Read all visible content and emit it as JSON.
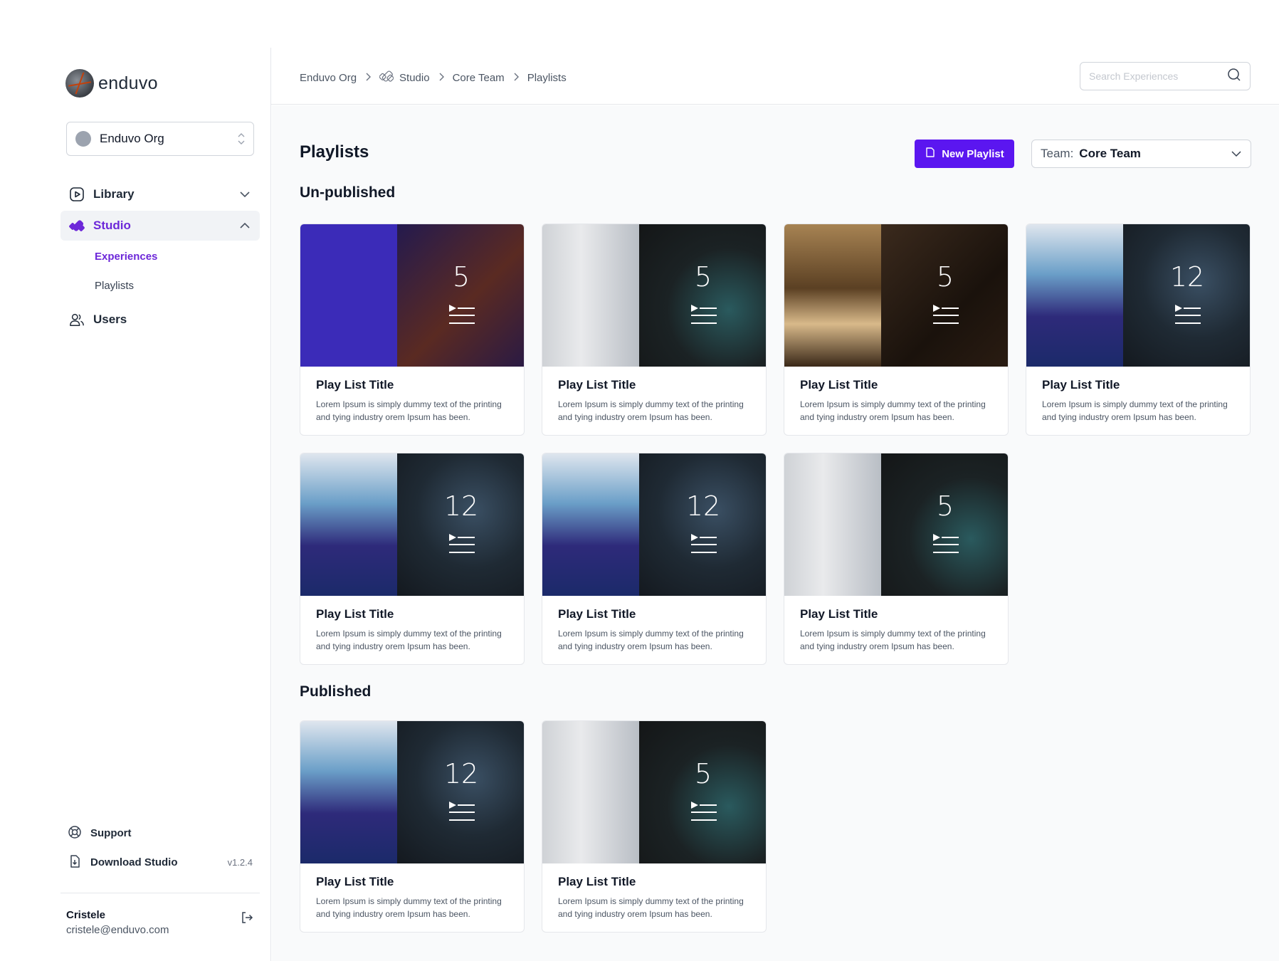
{
  "app": {
    "logo_text": "enduvo"
  },
  "org_select": {
    "name": "Enduvo Org"
  },
  "nav": {
    "library": "Library",
    "studio": "Studio",
    "studio_sub": {
      "experiences": "Experiences",
      "playlists": "Playlists"
    },
    "users": "Users"
  },
  "sidebar_bottom": {
    "support": "Support",
    "download": "Download Studio",
    "version": "v1.2.4"
  },
  "user": {
    "name": "Cristele",
    "email": "cristele@enduvo.com"
  },
  "breadcrumb": [
    "Enduvo Org",
    "Studio",
    "Core Team",
    "Playlists"
  ],
  "search": {
    "placeholder": "Search Experiences",
    "value": ""
  },
  "page": {
    "title": "Playlists",
    "new_button": "New Playlist",
    "team_label": "Team:",
    "team_value": "Core Team"
  },
  "sections": {
    "unpublished": {
      "title": "Un-published",
      "cards": [
        {
          "title": "Play List Title",
          "count": "5",
          "desc": "Lorem Ipsum is simply dummy text of the printing and tying industry orem Ipsum has been.",
          "art": "purple"
        },
        {
          "title": "Play List Title",
          "count": "5",
          "desc": "Lorem Ipsum is simply dummy text of the printing and tying industry orem Ipsum has been.",
          "art": "vr"
        },
        {
          "title": "Play List Title",
          "count": "5",
          "desc": "Lorem Ipsum is simply dummy text of the printing and tying industry orem Ipsum has been.",
          "art": "room"
        },
        {
          "title": "Play List Title",
          "count": "12",
          "desc": "Lorem Ipsum is simply dummy text of the printing and tying industry orem Ipsum has been.",
          "art": "hand"
        },
        {
          "title": "Play List Title",
          "count": "12",
          "desc": "Lorem Ipsum is simply dummy text of the printing and tying industry orem Ipsum has been.",
          "art": "hand"
        },
        {
          "title": "Play List Title",
          "count": "12",
          "desc": "Lorem Ipsum is simply dummy text of the printing and tying industry orem Ipsum has been.",
          "art": "hand"
        },
        {
          "title": "Play List Title",
          "count": "5",
          "desc": "Lorem Ipsum is simply dummy text of the printing and tying industry orem Ipsum has been.",
          "art": "vr"
        }
      ]
    },
    "published": {
      "title": "Published",
      "cards": [
        {
          "title": "Play List Title",
          "count": "12",
          "desc": "Lorem Ipsum is simply dummy text of the printing and tying industry orem Ipsum has been.",
          "art": "hand"
        },
        {
          "title": "Play List Title",
          "count": "5",
          "desc": "Lorem Ipsum is simply dummy text of the printing and tying industry orem Ipsum has been.",
          "art": "vr"
        }
      ]
    }
  },
  "colors": {
    "accent": "#5b16f0",
    "active_nav": "#6d28d9"
  }
}
